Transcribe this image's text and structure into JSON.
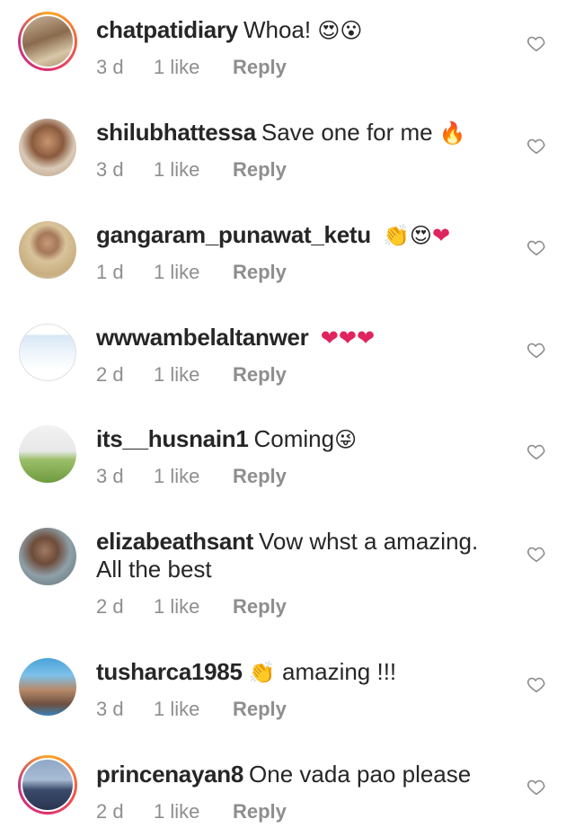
{
  "comments": [
    {
      "username": "chatpatidiary",
      "text": "Whoa!",
      "emojis": [
        "smiling-face-with-heart-eyes",
        "face-with-open-mouth"
      ],
      "age": "3 d",
      "likes": "1 like",
      "reply": "Reply",
      "story_ring": true
    },
    {
      "username": "shilubhattessa",
      "text": "Save one for me",
      "emojis": [
        "fire"
      ],
      "age": "3 d",
      "likes": "1 like",
      "reply": "Reply",
      "story_ring": false
    },
    {
      "username": "gangaram_punawat_ketu",
      "text": "",
      "emojis": [
        "clapping-hands",
        "smiling-face-with-heart-eyes",
        "red-heart"
      ],
      "age": "1 d",
      "likes": "1 like",
      "reply": "Reply",
      "story_ring": false
    },
    {
      "username": "wwwambelaltanwer",
      "text": "",
      "emojis": [
        "red-heart",
        "red-heart",
        "red-heart"
      ],
      "age": "2 d",
      "likes": "1 like",
      "reply": "Reply",
      "story_ring": false
    },
    {
      "username": "its__husnain1",
      "text": "Coming",
      "emojis": [
        "zany-face"
      ],
      "age": "3 d",
      "likes": "1 like",
      "reply": "Reply",
      "story_ring": false
    },
    {
      "username": "elizabeathsant",
      "text": "Vow whst a amazing.",
      "text_line2": "All the best",
      "emojis": [],
      "age": "2 d",
      "likes": "1 like",
      "reply": "Reply",
      "story_ring": false
    },
    {
      "username": "tusharca1985",
      "text": "amazing !!!",
      "emojis_before_text": [
        "clapping-hands"
      ],
      "emojis": [],
      "age": "3 d",
      "likes": "1 like",
      "reply": "Reply",
      "story_ring": false
    },
    {
      "username": "princenayan8",
      "text": "One vada pao please",
      "emojis": [],
      "age": "2 d",
      "likes": "1 like",
      "reply": "Reply",
      "story_ring": true
    }
  ],
  "colors": {
    "username": "#262626",
    "text": "#262626",
    "meta": "#8e8e8e",
    "heart_outline": "#8e8e8e",
    "story_ring_start": "#f9a825",
    "story_ring_end": "#c13584"
  }
}
